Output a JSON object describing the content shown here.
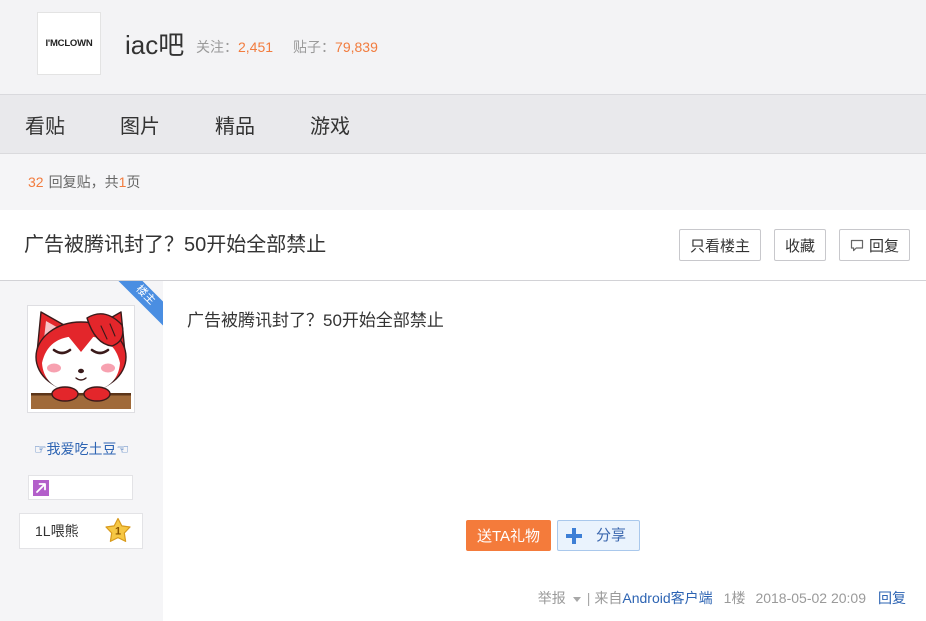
{
  "colors": {
    "accent": "#f27c3e",
    "link": "#2d64b3",
    "ribbon": "#4a8ee2",
    "gift_button": "#f47b3b",
    "badge_purple": "#b35fca",
    "level_gold": "#f6c744"
  },
  "icons": {
    "reply": "comment-icon",
    "share": "plus-icon",
    "member_badge": "purple-arrow-badge-icon",
    "level": "gold-star-level-icon",
    "report_menu": "chevron-down-icon"
  },
  "header": {
    "logo_text": "I'MCLOWN",
    "forum_name": "iac吧",
    "follow_label": "关注：",
    "follow_count": "2,451",
    "posts_label": "贴子：",
    "posts_count": "79,839"
  },
  "nav": {
    "items": [
      {
        "label": "看贴"
      },
      {
        "label": "图片"
      },
      {
        "label": "精品"
      },
      {
        "label": "游戏"
      }
    ]
  },
  "reply_summary": {
    "count": "32",
    "label": "回复贴，共",
    "pages": "1",
    "page_suffix": "页"
  },
  "thread": {
    "title": "广告被腾讯封了？50开始全部禁止",
    "only_op_label": "只看楼主",
    "favorite_label": "收藏",
    "reply_label": "回复"
  },
  "post": {
    "op_ribbon": "楼主",
    "author": {
      "name": "☞我爱吃土豆☜",
      "level_name": "1L喂熊",
      "level": "1"
    },
    "content": "广告被腾讯封了？50开始全部禁止",
    "gift_label": "送TA礼物",
    "share_label": "分享",
    "footer": {
      "report_label": "举报",
      "separator": "|",
      "from_label": "来自",
      "client": "Android客户端",
      "floor": "1楼",
      "time": "2018-05-02 20:09",
      "reply_label": "回复"
    }
  }
}
